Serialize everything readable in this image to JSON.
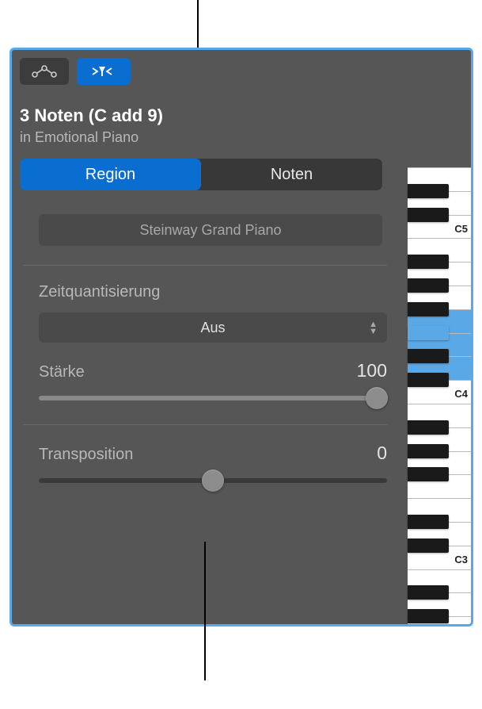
{
  "header": {
    "title": "3 Noten (C add 9)",
    "subtitle": "in Emotional Piano"
  },
  "tabs": {
    "region": "Region",
    "noten": "Noten"
  },
  "instrument": {
    "name": "Steinway Grand Piano"
  },
  "quantize": {
    "label": "Zeitquantisierung",
    "value": "Aus"
  },
  "strength": {
    "label": "Stärke",
    "value": "100",
    "percent": 100
  },
  "transpose": {
    "label": "Transposition",
    "value": "0",
    "percent": 50
  },
  "piano": {
    "labels": {
      "c5": "C5",
      "c4": "C4",
      "c3": "C3"
    }
  }
}
